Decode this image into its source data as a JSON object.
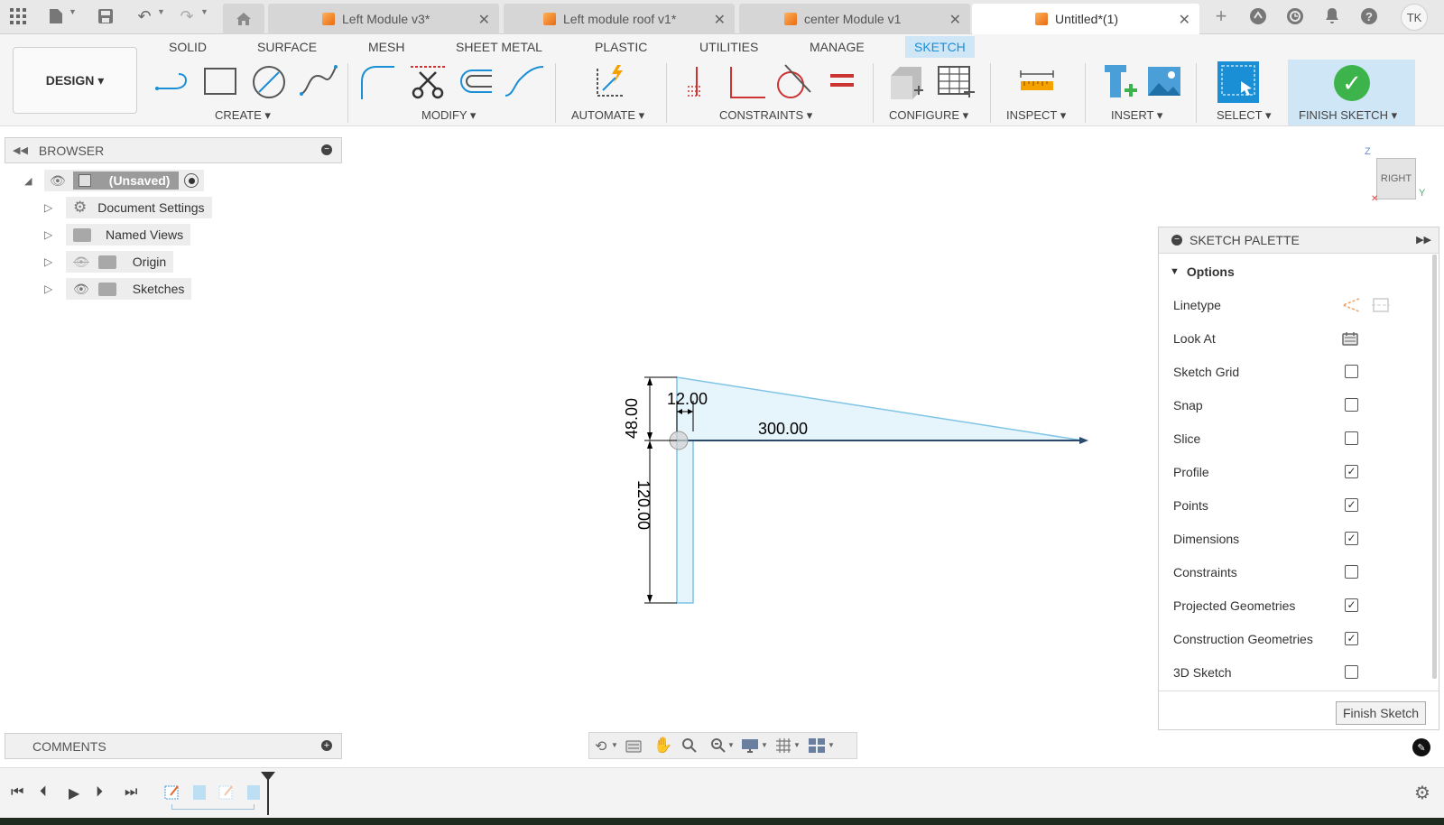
{
  "topbar": {
    "tabs": [
      {
        "label": "Left Module v3*"
      },
      {
        "label": "Left module roof v1*"
      },
      {
        "label": "center Module v1"
      },
      {
        "label": "Untitled*(1)"
      }
    ],
    "user_initials": "TK"
  },
  "ribbon": {
    "mode_tabs": [
      "SOLID",
      "SURFACE",
      "MESH",
      "SHEET METAL",
      "PLASTIC",
      "UTILITIES",
      "MANAGE",
      "SKETCH"
    ],
    "design_label": "DESIGN ▾",
    "groups": {
      "create": "CREATE ▾",
      "modify": "MODIFY ▾",
      "automate": "AUTOMATE ▾",
      "constraints": "CONSTRAINTS ▾",
      "configure": "CONFIGURE ▾",
      "inspect": "INSPECT ▾",
      "insert": "INSERT ▾",
      "select": "SELECT ▾",
      "finish_sketch": "FINISH SKETCH ▾"
    }
  },
  "browser": {
    "title": "BROWSER",
    "root": "(Unsaved)",
    "items": [
      {
        "label": "Document Settings"
      },
      {
        "label": "Named Views"
      },
      {
        "label": "Origin"
      },
      {
        "label": "Sketches"
      }
    ]
  },
  "canvas": {
    "viewcube_label": "RIGHT",
    "axis_z": "Z",
    "axis_y": "Y",
    "dimensions": {
      "d1": "48.00",
      "d2": "12.00",
      "d3": "300.00",
      "d4": "120.00"
    }
  },
  "palette": {
    "title": "SKETCH PALETTE",
    "section": "Options",
    "options": [
      {
        "label": "Linetype"
      },
      {
        "label": "Look At"
      },
      {
        "label": "Sketch Grid",
        "checked": false
      },
      {
        "label": "Snap",
        "checked": false
      },
      {
        "label": "Slice",
        "checked": false
      },
      {
        "label": "Profile",
        "checked": true
      },
      {
        "label": "Points",
        "checked": true
      },
      {
        "label": "Dimensions",
        "checked": true
      },
      {
        "label": "Constraints",
        "checked": false
      },
      {
        "label": "Projected Geometries",
        "checked": true
      },
      {
        "label": "Construction Geometries",
        "checked": true
      },
      {
        "label": "3D Sketch",
        "checked": false
      }
    ],
    "finish_button": "Finish Sketch"
  },
  "comments": {
    "title": "COMMENTS"
  },
  "colors": {
    "accent": "#1a8fd6",
    "sketch_fill": "#e6f4fb",
    "sketch_stroke": "#7fc4e6",
    "finish_green": "#3cb44b"
  }
}
